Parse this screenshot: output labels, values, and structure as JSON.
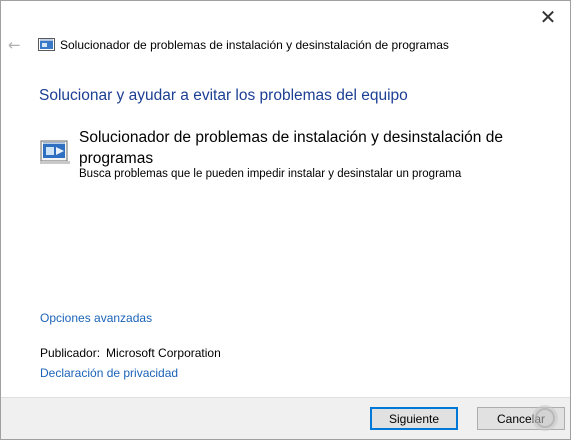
{
  "window": {
    "close_glyph": "✕",
    "back_glyph": "←",
    "title": "Solucionador de problemas de instalación y desinstalación de programas"
  },
  "main": {
    "heading": "Solucionar y ayudar a evitar los problemas del equipo",
    "item": {
      "title": "Solucionador de problemas de instalación y desinstalación de programas",
      "description": "Busca problemas que le pueden impedir instalar y desinstalar un programa",
      "icon": "installer-icon"
    },
    "advanced_link": "Opciones avanzadas",
    "publisher_label": "Publicador:",
    "publisher_value": "Microsoft Corporation",
    "privacy_link": "Declaración de privacidad"
  },
  "footer": {
    "next_label": "Siguiente",
    "cancel_label": "Cancelar"
  },
  "colors": {
    "heading": "#1c3f94",
    "link": "#1b63b8",
    "focus": "#0078d7"
  }
}
